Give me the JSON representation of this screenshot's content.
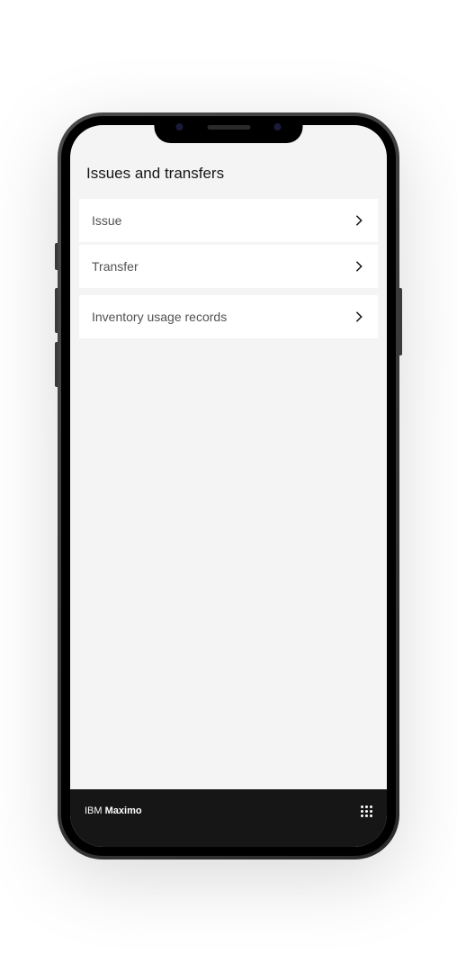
{
  "header": {
    "title": "Issues and transfers"
  },
  "menu": {
    "group1": [
      {
        "label": "Issue"
      },
      {
        "label": "Transfer"
      }
    ],
    "group2": [
      {
        "label": "Inventory usage records"
      }
    ]
  },
  "footer": {
    "brand_prefix": "IBM ",
    "brand_name": "Maximo"
  }
}
